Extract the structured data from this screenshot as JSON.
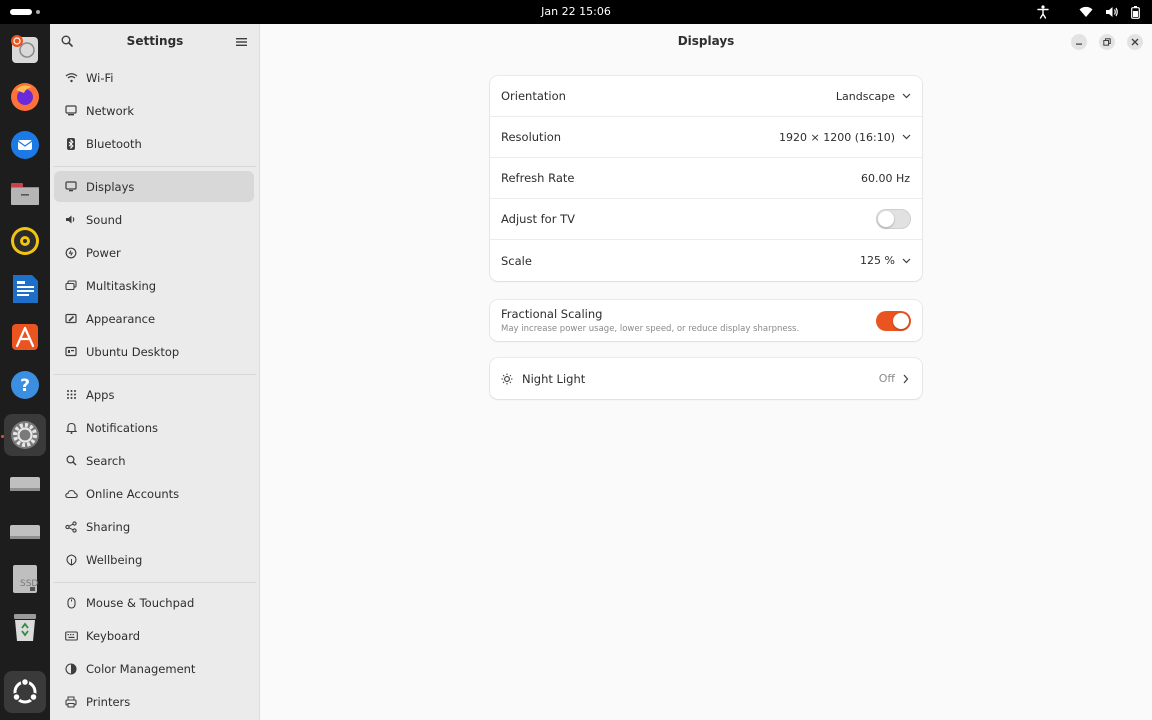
{
  "topbar": {
    "clock": "Jan 22  15:06"
  },
  "dock": {
    "items": [
      {
        "name": "ubuntu-installer",
        "color": "#e95420"
      },
      {
        "name": "firefox",
        "color": "#ff7139"
      },
      {
        "name": "thunderbird",
        "color": "#1c7ae6"
      },
      {
        "name": "files",
        "color": "#c7424b"
      },
      {
        "name": "rhythmbox",
        "color": "#f1c40f"
      },
      {
        "name": "libreoffice-writer",
        "color": "#1e6fc8"
      },
      {
        "name": "app-center",
        "color": "#e95420"
      },
      {
        "name": "help",
        "color": "#3b8ee0"
      },
      {
        "name": "settings",
        "color": "#bdbdbd"
      },
      {
        "name": "drive-1",
        "color": "#bfbfbf"
      },
      {
        "name": "drive-2",
        "color": "#bfbfbf"
      },
      {
        "name": "ssd-drive",
        "color": "#bfbfbf"
      },
      {
        "name": "trash",
        "color": "#d7d7d7"
      },
      {
        "name": "show-apps",
        "color": "#4a4a4a"
      }
    ]
  },
  "sidebar": {
    "title": "Settings",
    "items": [
      {
        "label": "Wi-Fi",
        "icon": "wifi-icon"
      },
      {
        "label": "Network",
        "icon": "network-icon"
      },
      {
        "label": "Bluetooth",
        "icon": "bluetooth-icon"
      },
      {
        "label": "Displays",
        "icon": "display-icon"
      },
      {
        "label": "Sound",
        "icon": "sound-icon"
      },
      {
        "label": "Power",
        "icon": "power-icon"
      },
      {
        "label": "Multitasking",
        "icon": "multitasking-icon"
      },
      {
        "label": "Appearance",
        "icon": "appearance-icon"
      },
      {
        "label": "Ubuntu Desktop",
        "icon": "ubuntu-desktop-icon"
      },
      {
        "label": "Apps",
        "icon": "apps-icon"
      },
      {
        "label": "Notifications",
        "icon": "bell-icon"
      },
      {
        "label": "Search",
        "icon": "search-icon"
      },
      {
        "label": "Online Accounts",
        "icon": "cloud-icon"
      },
      {
        "label": "Sharing",
        "icon": "share-icon"
      },
      {
        "label": "Wellbeing",
        "icon": "wellbeing-icon"
      },
      {
        "label": "Mouse & Touchpad",
        "icon": "mouse-icon"
      },
      {
        "label": "Keyboard",
        "icon": "keyboard-icon"
      },
      {
        "label": "Color Management",
        "icon": "color-icon"
      },
      {
        "label": "Printers",
        "icon": "printer-icon"
      }
    ],
    "selected": "Displays"
  },
  "main": {
    "title": "Displays",
    "display_settings": {
      "orientation": {
        "label": "Orientation",
        "value": "Landscape"
      },
      "resolution": {
        "label": "Resolution",
        "value": "1920 × 1200 (16:10)"
      },
      "refresh_rate": {
        "label": "Refresh Rate",
        "value": "60.00 Hz"
      },
      "adjust_tv": {
        "label": "Adjust for TV",
        "enabled": false
      },
      "scale": {
        "label": "Scale",
        "value": "125 %"
      }
    },
    "fractional_scaling": {
      "label": "Fractional Scaling",
      "description": "May increase power usage, lower speed, or reduce display sharpness.",
      "enabled": true
    },
    "night_light": {
      "label": "Night Light",
      "value": "Off"
    }
  },
  "colors": {
    "accent": "#e95420",
    "selected_bg": "#d8d8d8"
  }
}
